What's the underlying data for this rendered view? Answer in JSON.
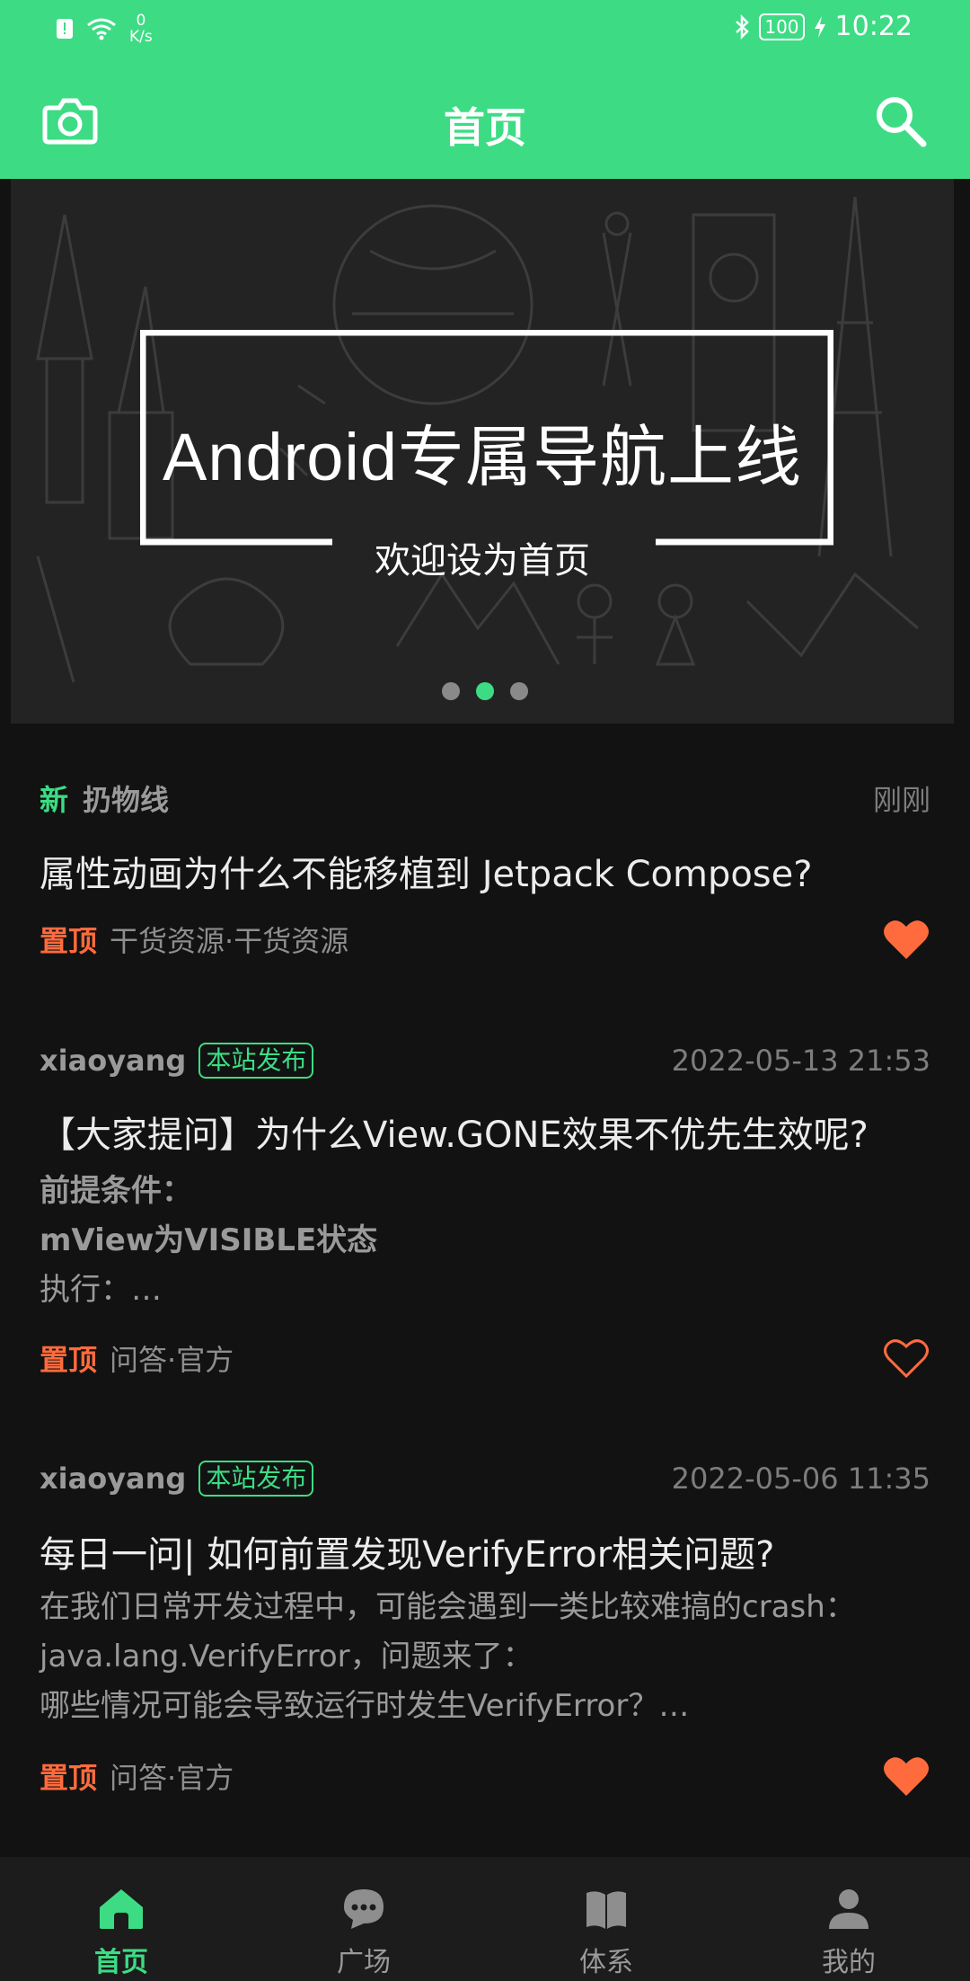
{
  "status_bar": {
    "net_speed_value": "0",
    "net_speed_unit": "K/s",
    "battery": "100",
    "time": "10:22"
  },
  "app_bar": {
    "title": "首页"
  },
  "banner": {
    "title": "Android专属导航上线",
    "subtitle": "欢迎设为首页",
    "page_count": 3,
    "active_index": 1
  },
  "articles": [
    {
      "new_tag": "新",
      "author": "扔物线",
      "time": "刚刚",
      "title": "属性动画为什么不能移植到 Jetpack Compose?",
      "pin": "置顶",
      "chapter": "干货资源·干货资源",
      "liked": true
    },
    {
      "author": "xiaoyang",
      "badge": "本站发布",
      "time": "2022-05-13 21:53",
      "title": "【大家提问】为什么View.GONE效果不优先生效呢?",
      "desc": [
        "前提条件：",
        "mView为VISIBLE状态",
        "执行：…"
      ],
      "pin": "置顶",
      "chapter": "问答·官方",
      "liked": false
    },
    {
      "author": "xiaoyang",
      "badge": "本站发布",
      "time": "2022-05-06 11:35",
      "title": "每日一问| 如何前置发现VerifyError相关问题?",
      "desc": [
        "在我们日常开发过程中，可能会遇到一类比较难搞的crash：",
        "java.lang.VerifyError，问题来了：",
        "哪些情况可能会导致运行时发生VerifyError？…"
      ],
      "pin": "置顶",
      "chapter": "问答·官方",
      "liked": true
    }
  ],
  "bottom_nav": [
    {
      "label": "首页",
      "icon": "home-icon",
      "active": true
    },
    {
      "label": "广场",
      "icon": "chat-bubble-icon",
      "active": false
    },
    {
      "label": "体系",
      "icon": "book-icon",
      "active": false
    },
    {
      "label": "我的",
      "icon": "person-icon",
      "active": false
    }
  ],
  "colors": {
    "accent": "#3ddc84",
    "pin": "#ff6b3d",
    "heart": "#ff6b3d",
    "background": "#121212"
  }
}
